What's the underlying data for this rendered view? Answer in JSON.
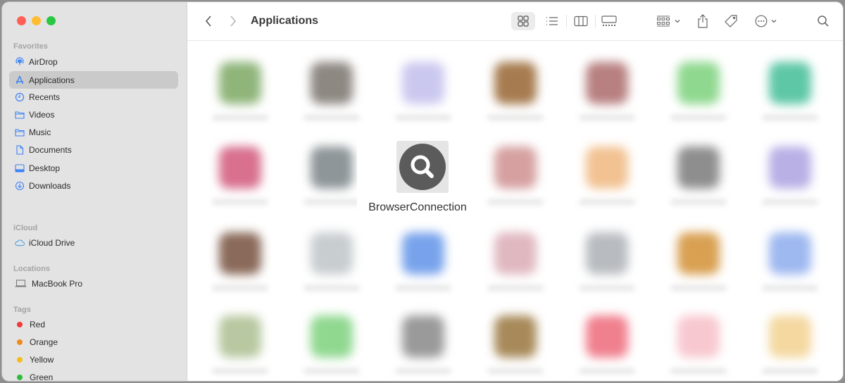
{
  "window": {
    "title": "Applications"
  },
  "traffic_lights": {
    "close": "#ff5f57",
    "minimize": "#febc2e",
    "zoom": "#28c840"
  },
  "sidebar": {
    "sections": [
      {
        "title": "Favorites",
        "items": [
          {
            "label": "AirDrop",
            "icon": "airdrop-icon"
          },
          {
            "label": "Applications",
            "icon": "applications-icon",
            "selected": true
          },
          {
            "label": "Recents",
            "icon": "clock-icon"
          },
          {
            "label": "Videos",
            "icon": "folder-icon"
          },
          {
            "label": "Music",
            "icon": "folder-icon"
          },
          {
            "label": "Documents",
            "icon": "document-icon"
          },
          {
            "label": "Desktop",
            "icon": "desktop-icon"
          },
          {
            "label": "Downloads",
            "icon": "download-icon"
          }
        ]
      },
      {
        "title": "iCloud",
        "items": [
          {
            "label": "iCloud Drive",
            "icon": "cloud-icon"
          }
        ]
      },
      {
        "title": "Locations",
        "items": [
          {
            "label": "MacBook Pro",
            "icon": "laptop-icon"
          }
        ]
      },
      {
        "title": "Tags",
        "items": [
          {
            "label": "Red",
            "color": "#f03a3a"
          },
          {
            "label": "Orange",
            "color": "#f08a1c"
          },
          {
            "label": "Yellow",
            "color": "#f3bd1b"
          },
          {
            "label": "Green",
            "color": "#2dbd3a"
          }
        ]
      }
    ]
  },
  "toolbar": {
    "back": "back-icon",
    "forward": "forward-icon",
    "view_modes": [
      "icon-view",
      "list-view",
      "column-view",
      "gallery-view"
    ],
    "active_view": "icon-view",
    "group": "group-icon",
    "share": "share-icon",
    "tags": "tag-icon",
    "more": "more-icon",
    "search": "search-icon"
  },
  "content": {
    "focused_app": {
      "label": "BrowserConnection",
      "icon": "magnifier-icon"
    },
    "blurred_icon_colors": [
      [
        "#8fb57a",
        "#8e8883",
        "#cbc8ef",
        "#a67b4f",
        "#b88080",
        "#8fd88f",
        "#5ec7a6"
      ],
      [
        "#d8708e",
        "#8e9699",
        "#e0b0c0",
        "#d6a0a0",
        "#f2c292",
        "#8e8e8e",
        "#b9b0e6"
      ],
      [
        "#8a6a5a",
        "#c8cdd0",
        "#78a3ec",
        "#e0b8c0",
        "#b8bcc0",
        "#d9a052",
        "#9eb8f0"
      ],
      [
        "#b8c8a0",
        "#90d890",
        "#9a9a9a",
        "#a88a5a",
        "#f0808e",
        "#f8c8d0",
        "#f4d8a0"
      ]
    ]
  }
}
